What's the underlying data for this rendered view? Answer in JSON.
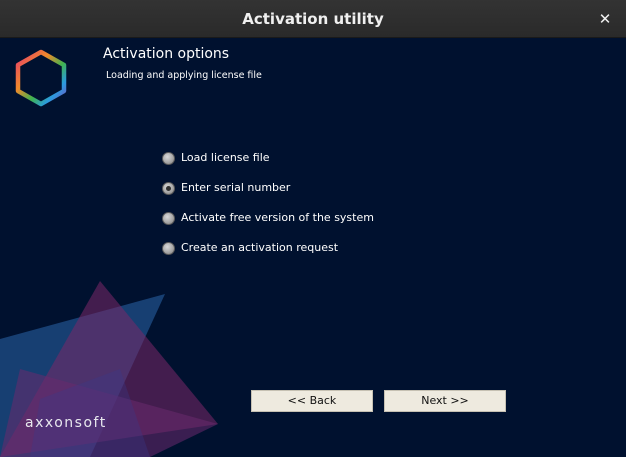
{
  "window": {
    "title": "Activation utility",
    "close_glyph": "✕"
  },
  "header": {
    "title": "Activation options",
    "subtitle": "Loading and applying license file",
    "logo_icon": "hexagon-logo-icon"
  },
  "options": [
    {
      "label": "Load license file",
      "checked": false
    },
    {
      "label": "Enter serial number",
      "checked": true
    },
    {
      "label": "Activate free version of the system",
      "checked": false
    },
    {
      "label": "Create an activation request",
      "checked": false
    }
  ],
  "buttons": {
    "back_label": "<< Back",
    "next_label": "Next >>"
  },
  "brand": {
    "text": "axxonsoft"
  },
  "colors": {
    "background": "#00112f",
    "titlebar": "#2f2f2f",
    "button": "#eeeadf",
    "deco_magenta": "#7a2868",
    "deco_blue": "#1f4f8a"
  }
}
